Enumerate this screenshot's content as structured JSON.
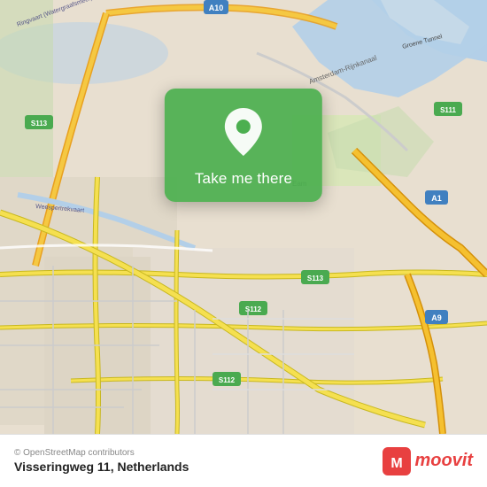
{
  "map": {
    "center_lat": 52.33,
    "center_lon": 4.93,
    "location": "Amsterdam, Netherlands"
  },
  "overlay": {
    "button_label": "Take me there"
  },
  "footer": {
    "address": "Visseringweg 11, Netherlands",
    "credit": "© OpenStreetMap contributors",
    "logo_text": "moovit"
  },
  "route_badges": [
    "A10",
    "A1",
    "A9",
    "S111",
    "S112",
    "S113"
  ],
  "colors": {
    "green": "#4caf50",
    "road_yellow": "#f5e642",
    "road_white": "#ffffff",
    "water": "#b3d4e8",
    "land": "#e8e0d8",
    "accent_red": "#e84040"
  }
}
